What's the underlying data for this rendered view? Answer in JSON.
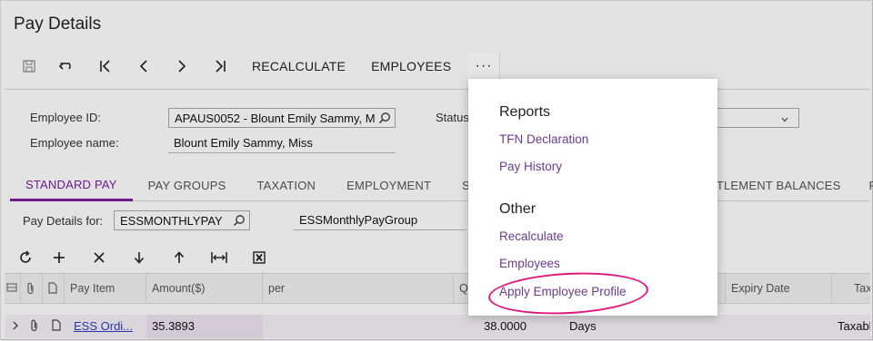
{
  "page": {
    "title": "Pay Details"
  },
  "toolbar": {
    "icons": [
      "save-icon",
      "undo-icon",
      "first-record-icon",
      "previous-icon",
      "next-icon",
      "last-record-icon"
    ],
    "recalculate_label": "RECALCULATE",
    "employees_label": "EMPLOYEES",
    "more_label": "···"
  },
  "form": {
    "employee_id_label": "Employee ID:",
    "employee_id_value": "APAUS0052 - Blount Emily Sammy, M",
    "employee_name_label": "Employee name:",
    "employee_name_value": "Blount Emily Sammy, Miss",
    "status_label": "Status"
  },
  "tabs": [
    {
      "label": "STANDARD PAY"
    },
    {
      "label": "PAY GROUPS"
    },
    {
      "label": "TAXATION"
    },
    {
      "label": "EMPLOYMENT"
    },
    {
      "label": "SET"
    },
    {
      "label": "ITLEMENT BALANCES"
    },
    {
      "label": "F"
    }
  ],
  "pay_details": {
    "label": "Pay Details for:",
    "value": "ESSMONTHLYPAY",
    "group_value": "ESSMonthlyPayGroup"
  },
  "grid": {
    "columns": [
      "Pay Item",
      "Amount($)",
      "per",
      "Qu",
      "Expiry Date",
      "Tax"
    ],
    "rows": [
      {
        "pay_item": "ESS Ordi...",
        "amount": "35.3893",
        "quantity": "38.0000",
        "unit": "Days",
        "tax": "Taxabl"
      }
    ]
  },
  "dropdown": {
    "reports_header": "Reports",
    "reports_items": [
      "TFN Declaration",
      "Pay History"
    ],
    "other_header": "Other",
    "other_items": [
      "Recalculate",
      "Employees",
      "Apply Employee Profile"
    ]
  },
  "colors": {
    "accent": "#7b1fa2",
    "link": "#6a3b8f",
    "highlight": "#e0177a"
  }
}
